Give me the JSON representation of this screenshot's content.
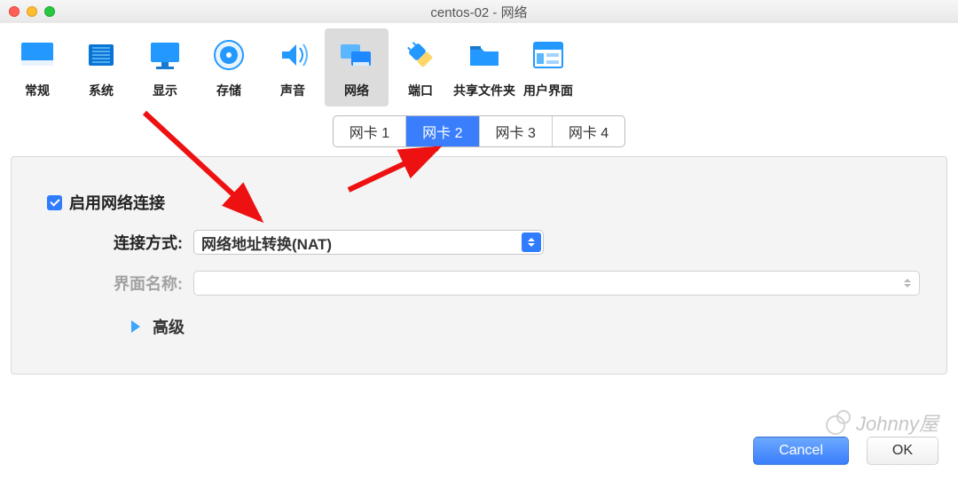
{
  "window": {
    "title": "centos-02 - 网络"
  },
  "toolbar": {
    "items": [
      {
        "label": "常规"
      },
      {
        "label": "系统"
      },
      {
        "label": "显示"
      },
      {
        "label": "存储"
      },
      {
        "label": "声音"
      },
      {
        "label": "网络"
      },
      {
        "label": "端口"
      },
      {
        "label": "共享文件夹"
      },
      {
        "label": "用户界面"
      }
    ]
  },
  "tabs": {
    "items": [
      "网卡 1",
      "网卡 2",
      "网卡 3",
      "网卡 4"
    ],
    "active": 1
  },
  "form": {
    "enable_label": "启用网络连接",
    "attached_label": "连接方式:",
    "attached_value": "网络地址转换(NAT)",
    "name_label": "界面名称:",
    "name_value": "",
    "advanced_label": "高级"
  },
  "buttons": {
    "cancel": "Cancel",
    "ok": "OK"
  },
  "watermark": "Johnny屋"
}
